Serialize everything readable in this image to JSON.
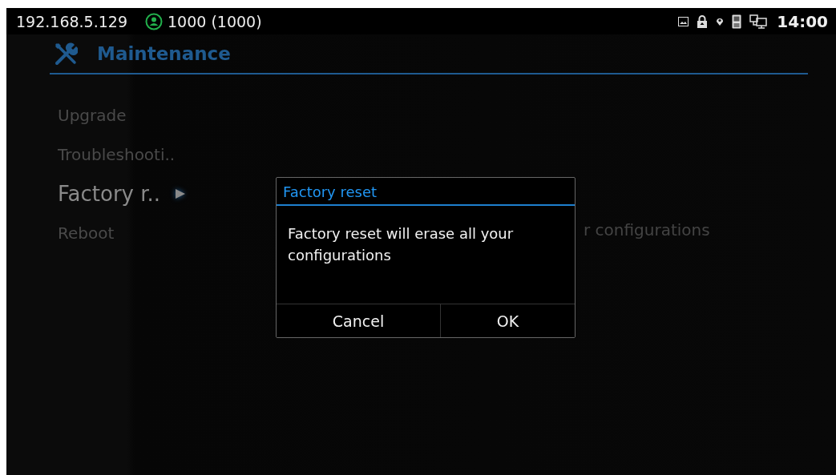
{
  "status_bar": {
    "ip": "192.168.5.129",
    "account": "1000 (1000)",
    "time": "14:00"
  },
  "header": {
    "title": "Maintenance"
  },
  "sidebar": {
    "items": [
      {
        "label": "Upgrade",
        "selected": false
      },
      {
        "label": "Troubleshooti..",
        "selected": false
      },
      {
        "label": "Factory r..",
        "selected": true
      },
      {
        "label": "Reboot",
        "selected": false
      }
    ]
  },
  "content": {
    "description": "r configurations"
  },
  "dialog": {
    "title": "Factory reset",
    "message": "Factory reset will erase all your configurations",
    "buttons": [
      "Cancel",
      "OK"
    ]
  }
}
